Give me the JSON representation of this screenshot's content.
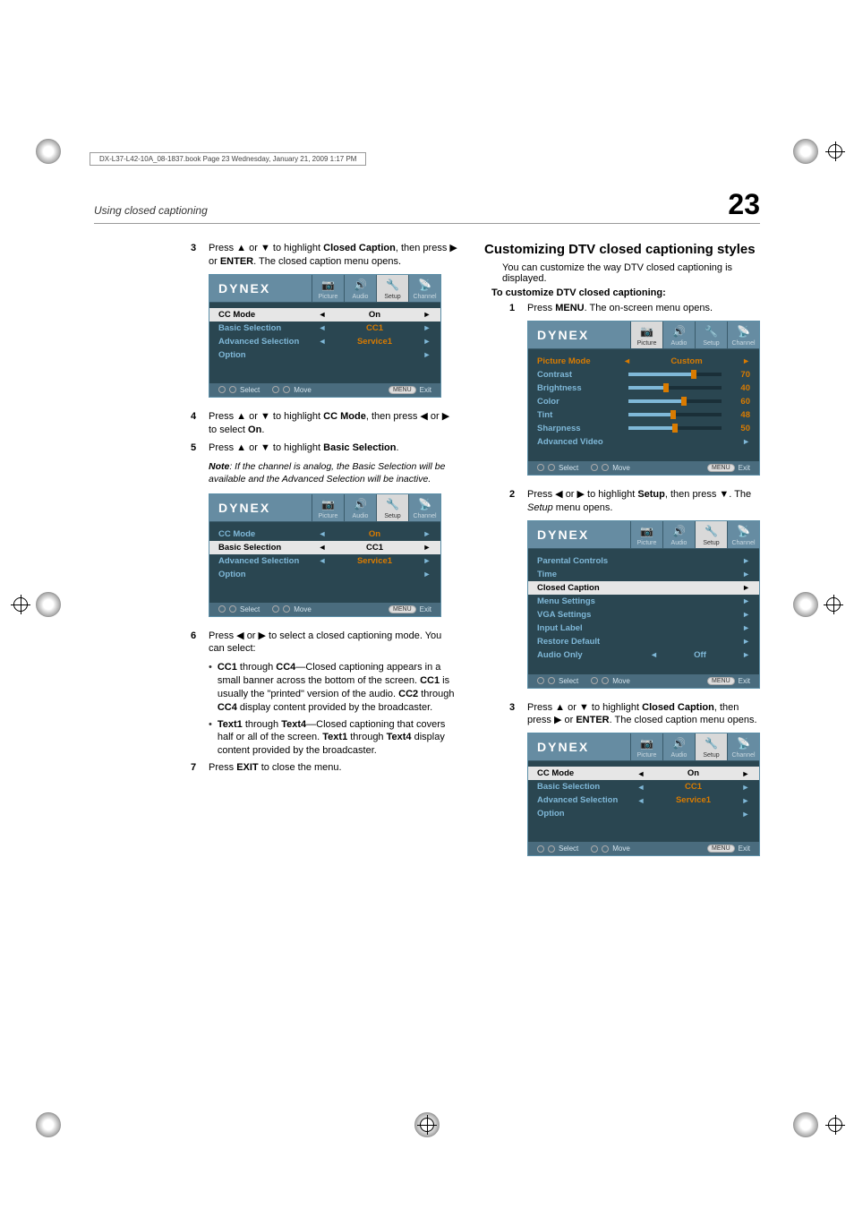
{
  "header_info": "DX-L37-L42-10A_08-1837.book  Page 23  Wednesday, January 21, 2009  1:17 PM",
  "breadcrumb": "Using closed captioning",
  "page_number": "23",
  "left": {
    "steps": [
      {
        "num": "3",
        "text_parts": [
          "Press ▲ or ▼ to highlight ",
          "Closed Caption",
          ", then press ▶ or ",
          "ENTER",
          ". The closed caption menu opens."
        ]
      },
      {
        "num": "4",
        "text_parts": [
          "Press ▲ or ▼ to highlight ",
          "CC Mode",
          ", then press ◀ or ▶ to select ",
          "On",
          "."
        ]
      },
      {
        "num": "5",
        "text_parts": [
          "Press ▲ or ▼ to highlight ",
          "Basic Selection",
          "."
        ]
      },
      {
        "num": "6",
        "text_parts": [
          "Press ◀ or ▶ to select a closed captioning mode. You can select:"
        ]
      },
      {
        "num": "7",
        "text_parts": [
          "Press ",
          "EXIT",
          " to close the menu."
        ]
      }
    ],
    "note": "Note: If the channel is analog, the Basic Selection will be available and the Advanced Selection will be inactive.",
    "bullets": [
      {
        "bold1": "CC1",
        "mid": " through ",
        "bold2": "CC4",
        "rest": "—Closed captioning appears in a small banner across the bottom of the screen. ",
        "bold3": "CC1",
        "rest2": " is usually the \"printed\" version of the audio. ",
        "bold4": "CC2",
        "rest3": " through ",
        "bold5": "CC4",
        "rest4": " display content provided by the broadcaster."
      },
      {
        "bold1": "Text1",
        "mid": " through ",
        "bold2": "Text4",
        "rest": "—Closed captioning that covers half or all of the screen. ",
        "bold3": "Text1",
        "rest2": " through ",
        "bold4": "Text4",
        "rest3": " display content provided by the broadcaster."
      }
    ]
  },
  "right": {
    "heading": "Customizing DTV closed captioning styles",
    "intro": "You can customize the way DTV closed captioning is displayed.",
    "subheading": "To customize DTV closed captioning:",
    "steps": [
      {
        "num": "1",
        "text_parts": [
          "Press ",
          "MENU",
          ". The on-screen menu opens."
        ]
      },
      {
        "num": "2",
        "text_parts": [
          "Press ◀ or ▶ to highlight ",
          "Setup",
          ", then press ▼. The ",
          "Setup",
          " menu opens."
        ],
        "italic_idx": 3
      },
      {
        "num": "3",
        "text_parts": [
          "Press ▲ or ▼ to highlight ",
          "Closed Caption",
          ", then press ▶ or ",
          "ENTER",
          ". The closed caption menu opens."
        ]
      }
    ]
  },
  "osd": {
    "logo": "DYNEX",
    "tabs": [
      "Picture",
      "Audio",
      "Setup",
      "Channel"
    ],
    "footer": {
      "select": "Select",
      "move": "Move",
      "menu": "MENU",
      "exit": "Exit"
    },
    "cc_menu": {
      "rows": [
        {
          "label": "CC Mode",
          "value": "On",
          "highlight": true
        },
        {
          "label": "Basic Selection",
          "value": "CC1"
        },
        {
          "label": "Advanced Selection",
          "value": "Service1"
        },
        {
          "label": "Option",
          "value": ""
        }
      ]
    },
    "cc_menu_basic": {
      "rows": [
        {
          "label": "CC Mode",
          "value": "On"
        },
        {
          "label": "Basic Selection",
          "value": "CC1",
          "highlight": true
        },
        {
          "label": "Advanced Selection",
          "value": "Service1"
        },
        {
          "label": "Option",
          "value": ""
        }
      ]
    },
    "picture_menu": {
      "rows": [
        {
          "label": "Picture Mode",
          "value": "Custom",
          "type": "value",
          "highlight_orange": true
        },
        {
          "label": "Contrast",
          "value": "70",
          "type": "slider",
          "pct": 70
        },
        {
          "label": "Brightness",
          "value": "40",
          "type": "slider",
          "pct": 40
        },
        {
          "label": "Color",
          "value": "60",
          "type": "slider",
          "pct": 60
        },
        {
          "label": "Tint",
          "value": "48",
          "type": "slider",
          "pct": 48
        },
        {
          "label": "Sharpness",
          "value": "50",
          "type": "slider",
          "pct": 50
        },
        {
          "label": "Advanced Video",
          "value": "",
          "type": "arrow"
        }
      ]
    },
    "setup_menu": {
      "rows": [
        {
          "label": "Parental Controls",
          "value": ""
        },
        {
          "label": "Time",
          "value": ""
        },
        {
          "label": "Closed Caption",
          "value": "",
          "highlight": true
        },
        {
          "label": "Menu Settings",
          "value": ""
        },
        {
          "label": "VGA Settings",
          "value": ""
        },
        {
          "label": "Input Label",
          "value": ""
        },
        {
          "label": "Restore Default",
          "value": ""
        },
        {
          "label": "Audio Only",
          "value": "Off",
          "type": "value"
        }
      ]
    }
  }
}
